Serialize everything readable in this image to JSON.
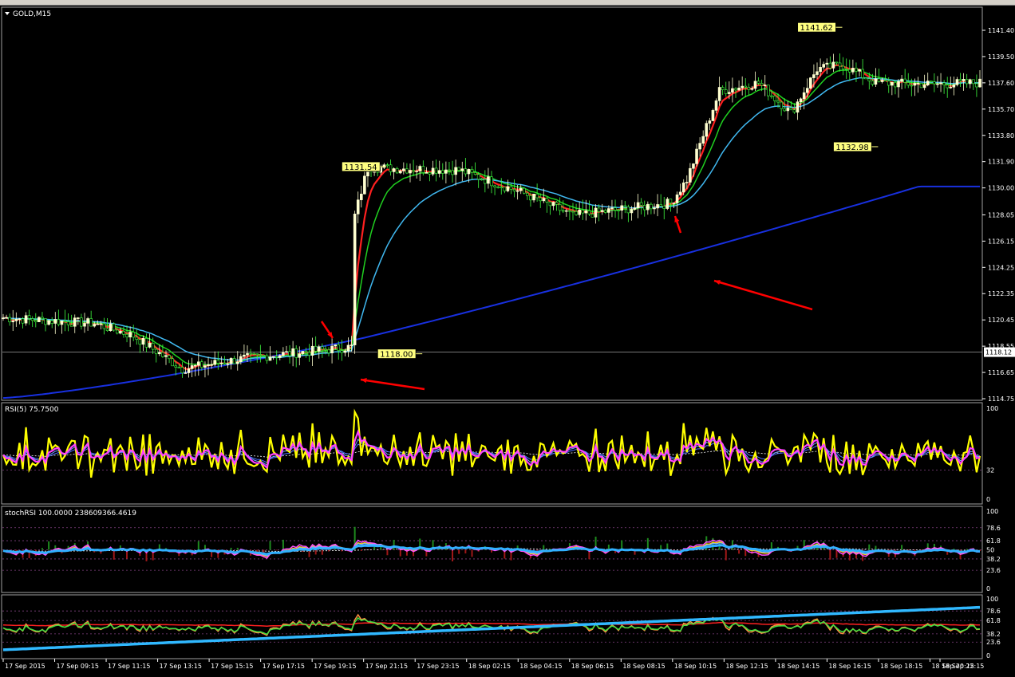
{
  "window": {
    "symbol_label": "GOLD,M15"
  },
  "main_panel": {
    "price_ticks": [
      "1141.40",
      "1139.50",
      "1137.60",
      "1135.70",
      "1133.80",
      "1131.90",
      "1130.00",
      "1128.05",
      "1126.15",
      "1124.25",
      "1122.35",
      "1120.45",
      "1118.55",
      "1116.65",
      "1114.75"
    ],
    "current_price": "1118.12",
    "annotations": [
      {
        "label": "1141.62",
        "price": 1141.62,
        "slot": 244
      },
      {
        "label": "1131.54",
        "price": 1131.54,
        "slot": 104
      },
      {
        "label": "1118.00",
        "price": 1118.0,
        "slot": 115
      },
      {
        "label": "1132.98",
        "price": 1132.98,
        "slot": 255
      }
    ]
  },
  "rsi_panel": {
    "label": "RSI(5) 75.7500",
    "levels": [
      "100",
      "32",
      "0"
    ]
  },
  "stoch_panel": {
    "label": "stochRSI 100.0000 238609366.4619",
    "levels": [
      "100",
      "78.6",
      "61.8",
      "50",
      "38.2",
      "23.6",
      "0"
    ]
  },
  "bottom_panel": {
    "levels": [
      "100",
      "78.6",
      "61.8",
      "38.2",
      "23.6",
      "0"
    ]
  },
  "time_axis": [
    "17 Sep 2015",
    "17 Sep 09:15",
    "17 Sep 11:15",
    "17 Sep 13:15",
    "17 Sep 15:15",
    "17 Sep 17:15",
    "17 Sep 19:15",
    "17 Sep 21:15",
    "17 Sep 23:15",
    "18 Sep 02:15",
    "18 Sep 04:15",
    "18 Sep 06:15",
    "18 Sep 08:15",
    "18 Sep 10:15",
    "18 Sep 12:15",
    "18 Sep 14:15",
    "18 Sep 16:15",
    "18 Sep 18:15",
    "18 Sep 20:15",
    "18 Sep 22:15"
  ],
  "colors": {
    "ma_fast": "#ff2020",
    "ma_mid": "#20d020",
    "ma_slow": "#40b8f0",
    "ma_long": "#1830e0",
    "candle_up": "#ffffd0",
    "candle_down": "#40ff40",
    "rsi_main": "#ffff00",
    "rsi_signal": "#ff40ff",
    "arrow": "#ff0000"
  }
}
